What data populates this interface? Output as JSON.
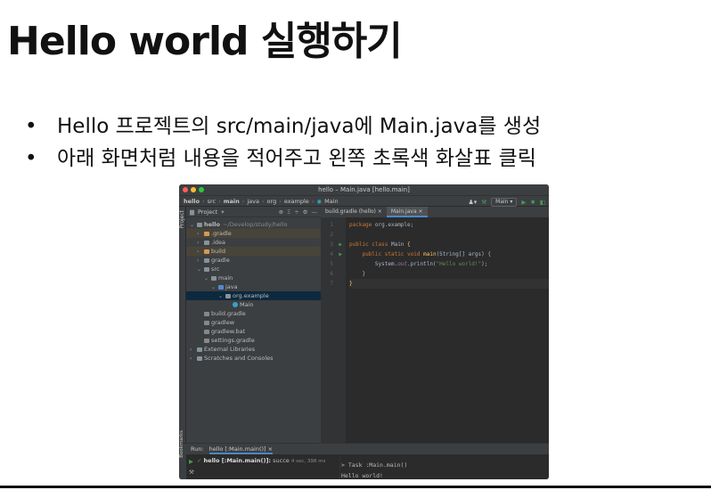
{
  "slide": {
    "title": "Hello world 실행하기",
    "bullets": [
      "Hello 프로젝트의 src/main/java에 Main.java를 생성",
      "아래 화면처럼 내용을 적어주고 왼쪽 초록색 화살표 클릭"
    ]
  },
  "ide": {
    "window_title": "hello – Main.java [hello.main]",
    "breadcrumbs": [
      "hello",
      "src",
      "main",
      "java",
      "org",
      "example",
      "Main"
    ],
    "run_config": "Main",
    "project_panel": {
      "header": "Project",
      "tree": [
        {
          "label": "hello",
          "suffix": "~/Develop/study/hello",
          "level": 0,
          "arrow": "v",
          "icon": "folder",
          "color": "#87939a"
        },
        {
          "label": ".gradle",
          "level": 1,
          "arrow": ">",
          "icon": "folder",
          "color": "#d29c54",
          "hl": true
        },
        {
          "label": ".idea",
          "level": 1,
          "arrow": ">",
          "icon": "folder",
          "color": "#87939a"
        },
        {
          "label": "build",
          "level": 1,
          "arrow": ">",
          "icon": "folder",
          "color": "#d29c54",
          "hl": true
        },
        {
          "label": "gradle",
          "level": 1,
          "arrow": ">",
          "icon": "folder",
          "color": "#87939a"
        },
        {
          "label": "src",
          "level": 1,
          "arrow": "v",
          "icon": "folder",
          "color": "#87939a"
        },
        {
          "label": "main",
          "level": 2,
          "arrow": "v",
          "icon": "folder",
          "color": "#87939a"
        },
        {
          "label": "java",
          "level": 3,
          "arrow": "v",
          "icon": "folder",
          "color": "#4f8cc9"
        },
        {
          "label": "org.example",
          "level": 4,
          "arrow": "v",
          "icon": "package",
          "color": "#87939a",
          "sel": true
        },
        {
          "label": "Main",
          "level": 5,
          "arrow": "",
          "icon": "class",
          "color": "#3aa0c8"
        },
        {
          "label": "build.gradle",
          "level": 1,
          "arrow": "",
          "icon": "file",
          "color": "#888888"
        },
        {
          "label": "gradlew",
          "level": 1,
          "arrow": "",
          "icon": "file",
          "color": "#888888"
        },
        {
          "label": "gradlew.bat",
          "level": 1,
          "arrow": "",
          "icon": "file",
          "color": "#888888"
        },
        {
          "label": "settings.gradle",
          "level": 1,
          "arrow": "",
          "icon": "file",
          "color": "#888888"
        },
        {
          "label": "External Libraries",
          "level": 0,
          "arrow": ">",
          "icon": "library",
          "color": "#87939a"
        },
        {
          "label": "Scratches and Consoles",
          "level": 0,
          "arrow": ">",
          "icon": "scratch",
          "color": "#87939a"
        }
      ]
    },
    "tabs": [
      {
        "label": "build.gradle (hello)",
        "active": false
      },
      {
        "label": "Main.java",
        "active": true
      }
    ],
    "code_lines": [
      "1",
      "2",
      "3",
      "4",
      "5",
      "6",
      "7"
    ],
    "run_panel": {
      "label": "Run:",
      "tab": "hello [:Main.main()]",
      "tree_item": "hello [:Main.main()]:",
      "status": "succe",
      "time": "4 sec, 398 ms",
      "output": [
        "> Task :Main.main()",
        "Hello world!"
      ]
    },
    "side_labels": {
      "project": "Project",
      "bookmarks": "Bookmarks"
    },
    "colors": {
      "run_green": "#499c54",
      "keyword": "#cc7832",
      "string": "#6a8759",
      "function": "#ffc66d"
    }
  }
}
